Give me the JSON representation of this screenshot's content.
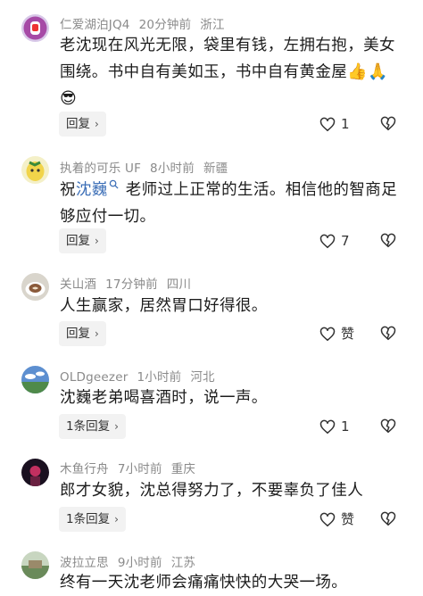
{
  "comments": [
    {
      "user": "仁爱湖泊JQ4",
      "time": "20分钟前",
      "location": "浙江",
      "text_parts": [
        "老沈现在风光无限，袋里有钱，左拥右抱，美女围绕。书中自有美如玉，书中自有黄金屋",
        "👍🙏",
        "",
        "😎"
      ],
      "button": "回复",
      "like": "1"
    },
    {
      "user": "执着的可乐 UF",
      "time": "8小时前",
      "location": "新疆",
      "text_parts": [
        "祝",
        "沈巍",
        "老师过上正常的生活。相信他的智商足够应付一切。"
      ],
      "button": "回复",
      "like": "7"
    },
    {
      "user": "关山酒",
      "time": "17分钟前",
      "location": "四川",
      "text": "人生赢家，居然胃口好得很。",
      "button": "回复",
      "like": "赞"
    },
    {
      "user": "OLDgeezer",
      "time": "1小时前",
      "location": "河北",
      "text": "沈巍老弟喝喜酒时，说一声。",
      "button": "1条回复",
      "like": "1"
    },
    {
      "user": "木鱼行舟",
      "time": "7小时前",
      "location": "重庆",
      "text": "郎才女貌，沈总得努力了，不要辜负了佳人",
      "button": "1条回复",
      "like": "赞"
    },
    {
      "user": "波拉立思",
      "time": "9小时前",
      "location": "江苏",
      "text": "终有一天沈老师会痛痛快快的大哭一场。"
    }
  ],
  "icons": {
    "heart": "heart-icon",
    "broken_heart": "dislike-heart-icon",
    "chevron": "chevron-right-icon",
    "search": "search-icon"
  },
  "colors": {
    "mention": "#3d6fb7",
    "meta": "#8a8a8a",
    "button_bg": "#f2f2f2"
  }
}
